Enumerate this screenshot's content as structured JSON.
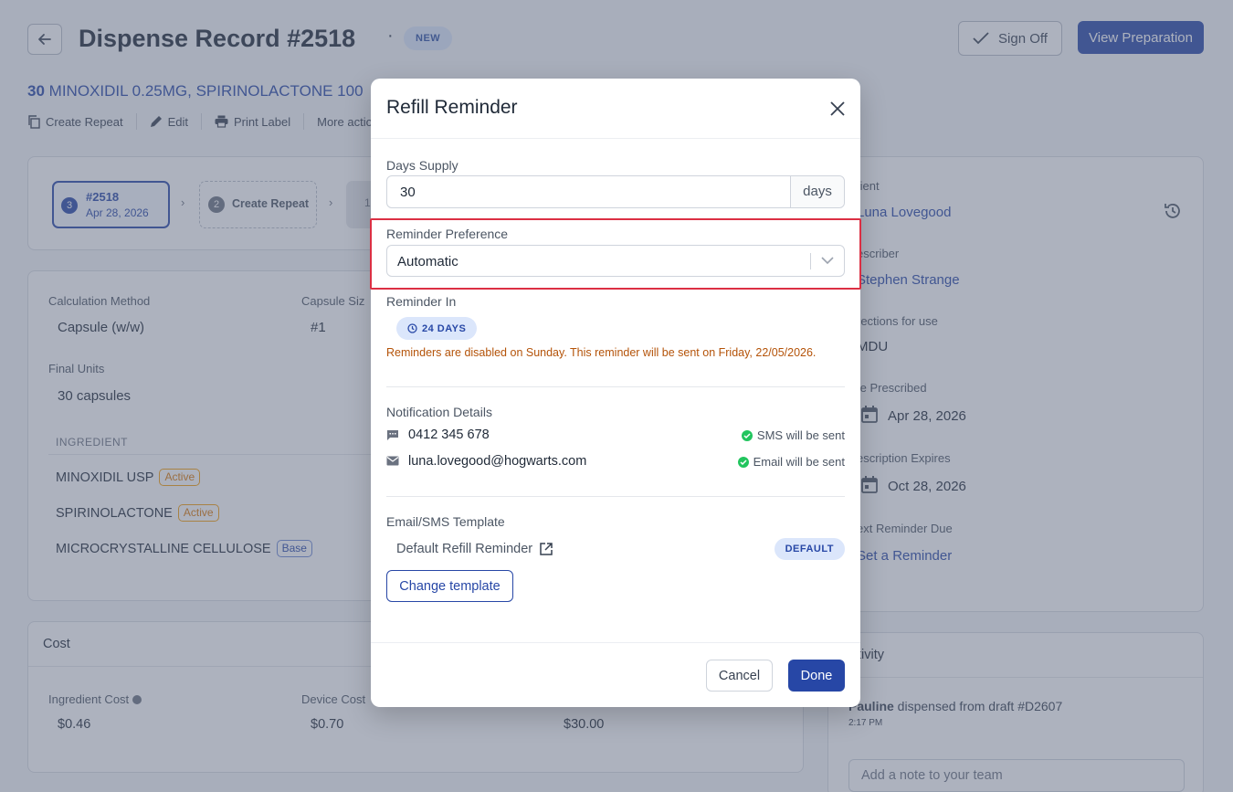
{
  "header": {
    "title": "Dispense Record #2518",
    "badge": "NEW",
    "sign_off": "Sign Off",
    "view_preparation": "View Preparation"
  },
  "rx": {
    "qty": "30",
    "name": "MINOXIDIL 0.25MG, SPIRINOLACTONE 100"
  },
  "actions": [
    "Create Repeat",
    "Edit",
    "Print Label",
    "More action"
  ],
  "steps": [
    {
      "num": "3",
      "title": "#2518",
      "date": "Apr 28, 2026"
    },
    {
      "num": "2",
      "title": "Create Repeat"
    },
    {
      "num": "1"
    }
  ],
  "details": {
    "calc_method_label": "Calculation Method",
    "calc_method_value": "Capsule (w/w)",
    "capsule_size_label": "Capsule Siz",
    "capsule_size_value": "#1",
    "final_units_label": "Final Units",
    "final_units_value": "30 capsules",
    "ingredient_header": "INGREDIENT",
    "ingredients": [
      {
        "name": "MINOXIDIL USP",
        "tag": "Active"
      },
      {
        "name": "SPIRINOLACTONE",
        "tag": "Active"
      },
      {
        "name": "MICROCRYSTALLINE CELLULOSE",
        "tag": "Base"
      }
    ]
  },
  "cost": {
    "title": "Cost",
    "ingredient_cost_label": "Ingredient Cost",
    "ingredient_cost_value": "$0.46",
    "device_cost_label": "Device Cost",
    "device_cost_value": "$0.70",
    "third_value": "$30.00"
  },
  "right_panel": {
    "patient_label": "tient",
    "patient_value": "Luna Lovegood",
    "prescriber_label": "escriber",
    "prescriber_value": "Stephen Strange",
    "directions_label": "rections for use",
    "directions_value": "MDU",
    "date_prescribed_label": "te Prescribed",
    "date_prescribed_value": "Apr 28, 2026",
    "expires_label": "escription Expires",
    "expires_value": "Oct 28, 2026",
    "next_reminder_label": "ext Reminder Due",
    "next_reminder_value": "Set a Reminder"
  },
  "activity": {
    "title": "tivity",
    "user": "Pauline",
    "text": " dispensed from draft #D2607",
    "time": "2:17 PM",
    "note_placeholder": "Add a note to your team"
  },
  "modal": {
    "title": "Refill Reminder",
    "days_supply_label": "Days Supply",
    "days_supply_value": "30",
    "days_suffix": "days",
    "reminder_pref_label": "Reminder Preference",
    "reminder_pref_value": "Automatic",
    "reminder_in_label": "Reminder In",
    "reminder_in_value": "24 DAYS",
    "warning": "Reminders are disabled on Sunday. This reminder will be sent on Friday, 22/05/2026.",
    "notification_label": "Notification Details",
    "phone": "0412 345 678",
    "sms_status": "SMS will be sent",
    "email": "luna.lovegood@hogwarts.com",
    "email_status": "Email will be sent",
    "template_label": "Email/SMS Template",
    "template_name": "Default Refill Reminder",
    "template_badge": "DEFAULT",
    "change_template": "Change template",
    "cancel": "Cancel",
    "done": "Done"
  },
  "colors": {
    "primary": "#2747a6",
    "highlight_border": "#dc2f43",
    "warning": "#b45309",
    "success": "#22c55e"
  }
}
